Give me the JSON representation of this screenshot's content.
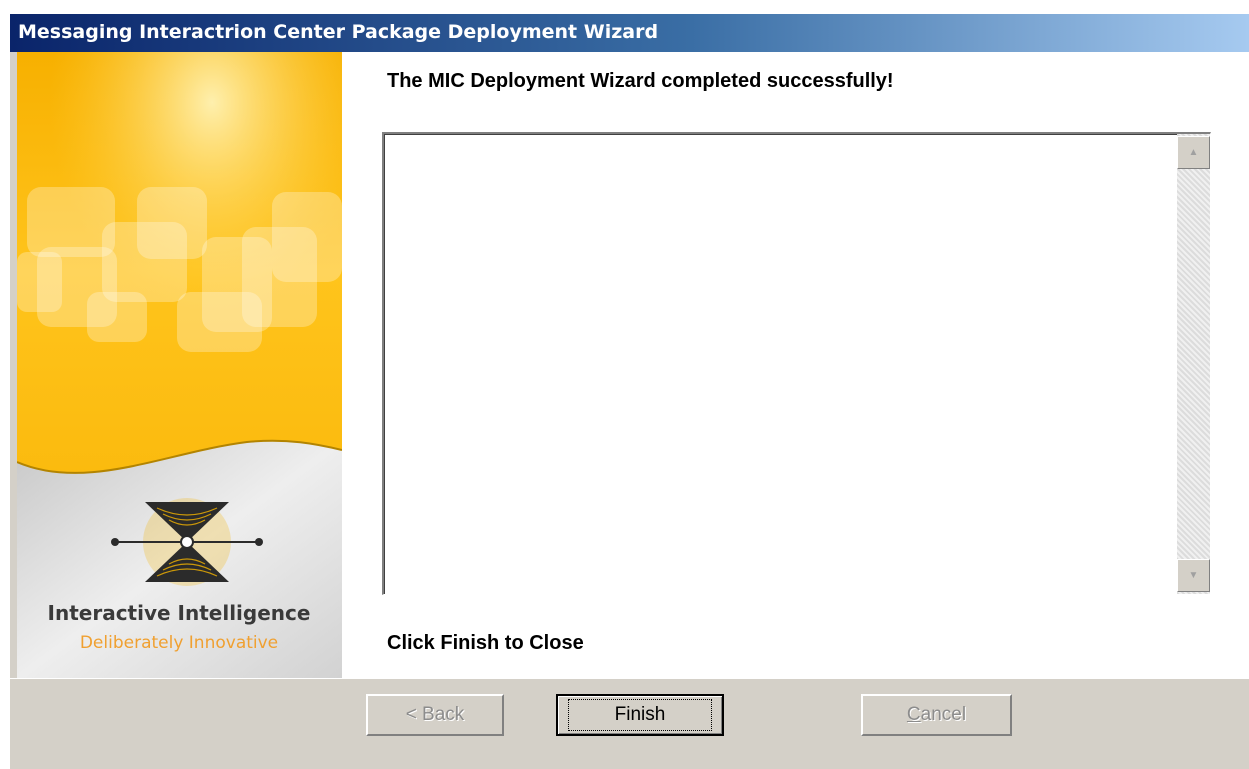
{
  "window": {
    "title": "Messaging Interactrion Center Package Deployment Wizard"
  },
  "sidebar": {
    "brand_name": "Interactive Intelligence",
    "tagline": "Deliberately Innovative",
    "accent_color": "#f5b400",
    "tagline_color": "#f0a030"
  },
  "content": {
    "success_heading": "The MIC Deployment Wizard completed successfully!",
    "log_text": "",
    "finish_hint": "Click Finish to Close"
  },
  "buttons": {
    "back_label": "< Back",
    "finish_label": "Finish",
    "cancel_first_letter": "C",
    "cancel_rest": "ancel"
  }
}
